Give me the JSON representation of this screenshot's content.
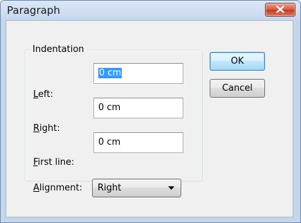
{
  "window": {
    "title": "Paragraph"
  },
  "indentation": {
    "group_label": "Indentation",
    "left": {
      "label_mnemonic": "L",
      "label_rest": "eft:",
      "value": "0 cm"
    },
    "right": {
      "label_mnemonic": "R",
      "label_rest": "ight:",
      "value": "0 cm"
    },
    "first_line": {
      "label_mnemonic": "F",
      "label_rest": "irst line:",
      "value": "0 cm"
    }
  },
  "alignment": {
    "label_mnemonic": "A",
    "label_rest": "lignment:",
    "selected": "Right"
  },
  "buttons": {
    "ok": "OK",
    "cancel": "Cancel"
  },
  "colors": {
    "title_bar": "#c4d6ec",
    "close_button": "#c23b22",
    "selection": "#3399ff"
  },
  "icons": {
    "close": "close-icon",
    "dropdown": "chevron-down-icon"
  }
}
